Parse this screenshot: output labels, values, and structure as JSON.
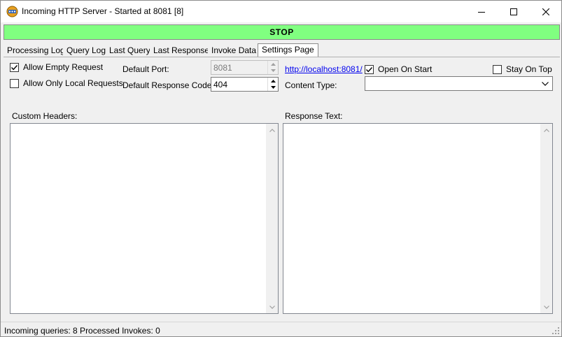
{
  "window": {
    "title": "Incoming HTTP Server - Started at 8081 [8]"
  },
  "toolbar": {
    "stop_label": "STOP",
    "stop_color": "#80ff80"
  },
  "tabs": [
    {
      "label": "Processing Log",
      "active": false
    },
    {
      "label": "Query Log",
      "active": false
    },
    {
      "label": "Last Query",
      "active": false
    },
    {
      "label": "Last Response",
      "active": false
    },
    {
      "label": "Invoke Data",
      "active": false
    },
    {
      "label": "Settings Page",
      "active": true
    }
  ],
  "settings": {
    "allow_empty_request": {
      "label": "Allow Empty Request",
      "checked": true
    },
    "allow_only_local": {
      "label": "Allow Only Local Requests",
      "checked": false
    },
    "default_port": {
      "label": "Default Port:",
      "value": "8081",
      "disabled": true
    },
    "default_response_code": {
      "label": "Default Response Code:",
      "value": "404"
    },
    "url_link": "http://localhost:8081/",
    "open_on_start": {
      "label": "Open On Start",
      "checked": true
    },
    "stay_on_top": {
      "label": "Stay On Top",
      "checked": false
    },
    "content_type": {
      "label": "Content Type:",
      "value": ""
    },
    "custom_headers": {
      "label": "Custom Headers:",
      "value": ""
    },
    "response_text": {
      "label": "Response Text:",
      "value": ""
    }
  },
  "status": {
    "text": "Incoming queries: 8  Processed Invokes: 0"
  },
  "icons": {
    "app": "server-app-icon",
    "minimize": "minimize-icon",
    "maximize": "maximize-icon",
    "close": "close-icon",
    "checkmark": "checkmark-icon",
    "spin_up": "spin-up-icon",
    "spin_down": "spin-down-icon",
    "dropdown": "chevron-down-icon",
    "scroll_up": "scroll-up-icon",
    "scroll_down": "scroll-down-icon",
    "size_grip": "size-grip-icon"
  }
}
